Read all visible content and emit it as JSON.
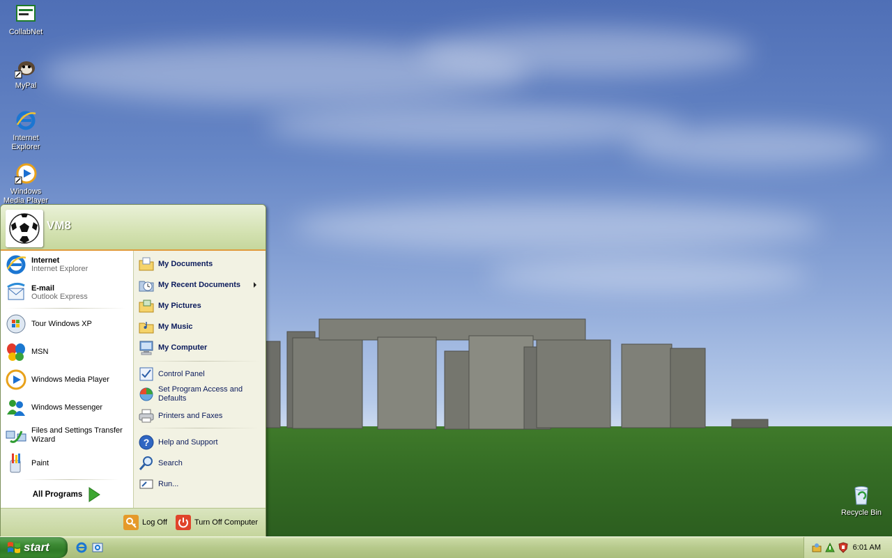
{
  "desktop": {
    "icons": [
      {
        "label": "CollabNet",
        "icon": "collabnet-icon"
      },
      {
        "label": "MyPal",
        "icon": "mypal-icon"
      },
      {
        "label": "Internet Explorer",
        "icon": "internet-explorer-icon"
      },
      {
        "label": "Windows Media Player",
        "icon": "windows-media-player-icon"
      },
      {
        "label": "Recycle Bin",
        "icon": "recycle-bin-icon"
      }
    ]
  },
  "start_menu": {
    "username": "VM8",
    "pinned": [
      {
        "title": "Internet",
        "subtitle": "Internet Explorer",
        "icon": "internet-explorer-icon"
      },
      {
        "title": "E-mail",
        "subtitle": "Outlook Express",
        "icon": "outlook-express-icon"
      }
    ],
    "recent": [
      {
        "label": "Tour Windows XP",
        "icon": "tour-windows-xp-icon"
      },
      {
        "label": "MSN",
        "icon": "msn-butterfly-icon"
      },
      {
        "label": "Windows Media Player",
        "icon": "windows-media-player-icon"
      },
      {
        "label": "Windows Messenger",
        "icon": "windows-messenger-icon"
      },
      {
        "label": "Files and Settings Transfer Wizard",
        "icon": "transfer-wizard-icon"
      },
      {
        "label": "Paint",
        "icon": "paint-icon"
      }
    ],
    "all_programs": "All Programs",
    "places": [
      {
        "label": "My Documents",
        "icon": "folder-documents-icon"
      },
      {
        "label": "My Recent Documents",
        "icon": "recent-documents-icon"
      },
      {
        "label": "My Pictures",
        "icon": "folder-pictures-icon"
      },
      {
        "label": "My Music",
        "icon": "folder-music-icon"
      },
      {
        "label": "My Computer",
        "icon": "my-computer-icon"
      }
    ],
    "system": [
      {
        "label": "Control Panel",
        "icon": "control-panel-icon"
      },
      {
        "label": "Set Program Access and Defaults",
        "icon": "program-access-icon"
      },
      {
        "label": "Printers and Faxes",
        "icon": "printer-icon"
      }
    ],
    "help": [
      {
        "label": "Help and Support",
        "icon": "help-icon"
      },
      {
        "label": "Search",
        "icon": "search-icon"
      },
      {
        "label": "Run...",
        "icon": "run-icon"
      }
    ],
    "log_off": "Log Off",
    "turn_off": "Turn Off Computer"
  },
  "taskbar": {
    "start_label": "start",
    "clock": "6:01 AM"
  },
  "colors": {
    "start_button": "#3d8a34",
    "taskbar": "#b6c98b",
    "menu_header": "#d4e2b2",
    "menu_accent": "#e09b3c"
  }
}
